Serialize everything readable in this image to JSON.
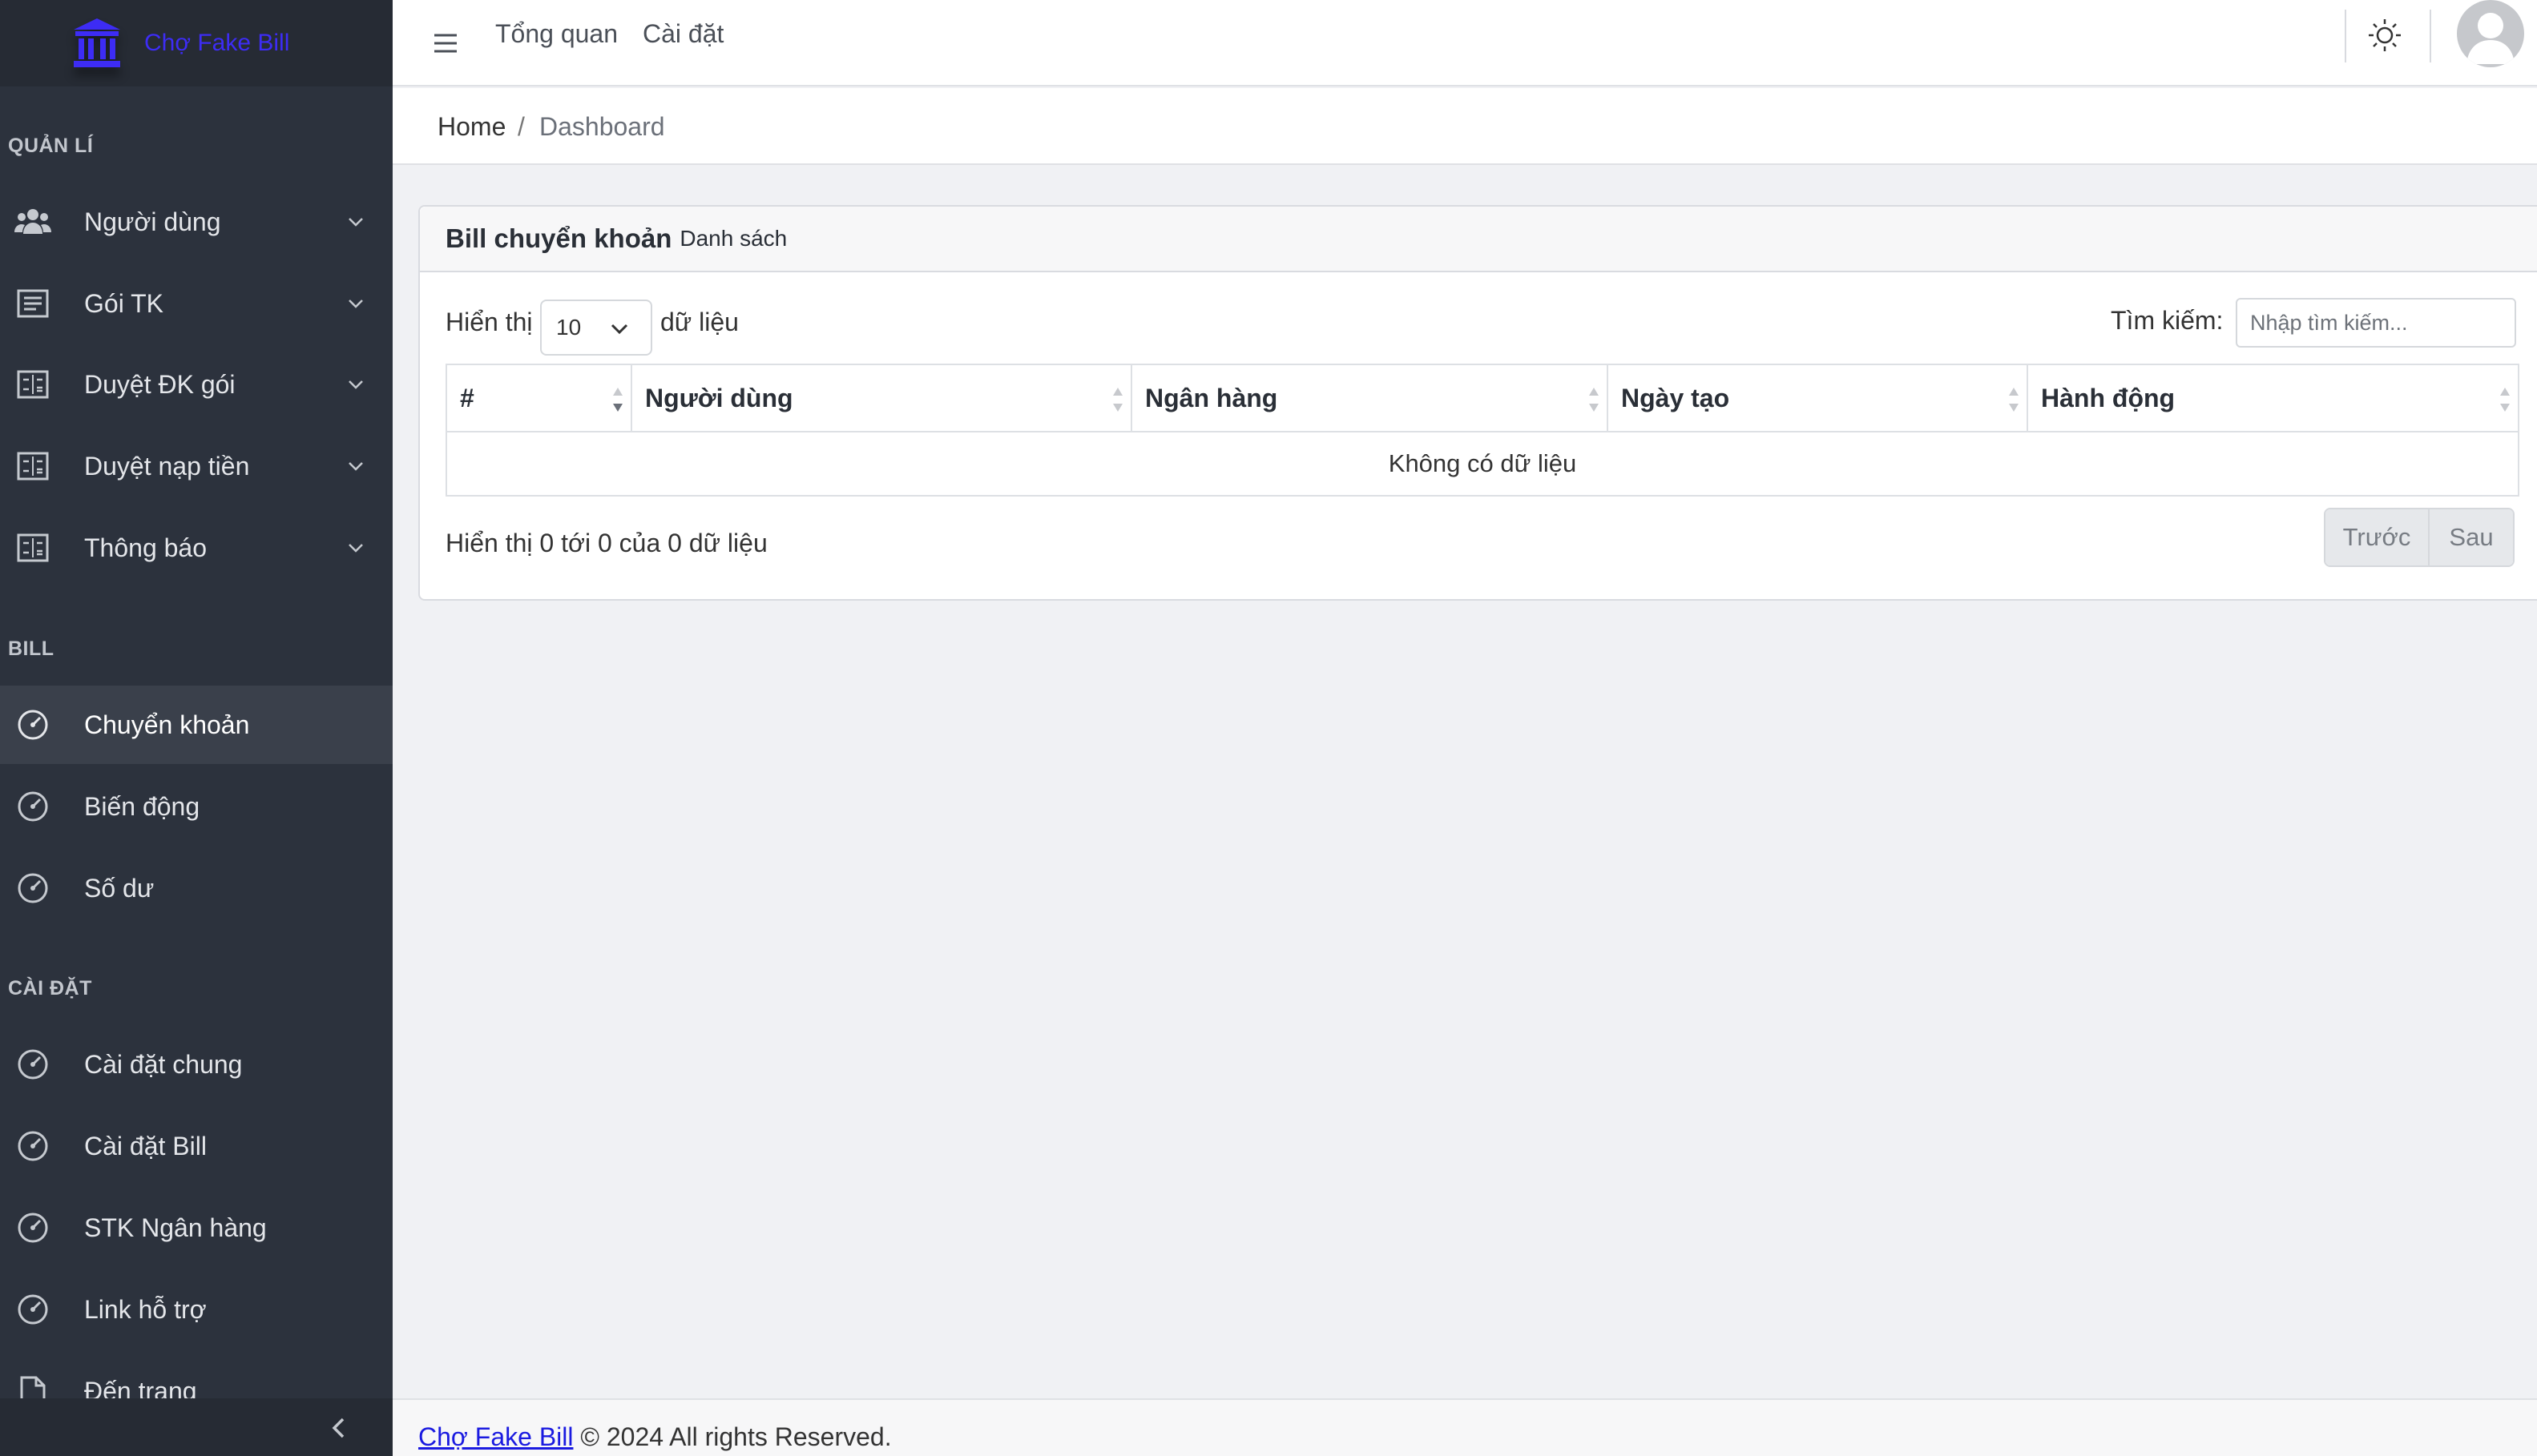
{
  "brand": {
    "name": "Chợ Fake Bill",
    "icon": "bank-icon",
    "color": "#3d2cf5"
  },
  "sidebar": {
    "sections": [
      {
        "title": "QUẢN LÍ"
      },
      {
        "title": "BILL"
      },
      {
        "title": "CÀI ĐẶT"
      }
    ],
    "items": [
      {
        "label": "Người dùng",
        "icon": "users-icon",
        "has_submenu": true
      },
      {
        "label": "Gói TK",
        "icon": "list-icon",
        "has_submenu": true
      },
      {
        "label": "Duyệt ĐK gói",
        "icon": "calculator-icon",
        "has_submenu": true
      },
      {
        "label": "Duyệt nạp tiền",
        "icon": "calculator-icon",
        "has_submenu": true
      },
      {
        "label": "Thông báo",
        "icon": "calculator-icon",
        "has_submenu": true
      },
      {
        "label": "Chuyển khoản",
        "icon": "speedometer-icon",
        "active": true
      },
      {
        "label": "Biến động",
        "icon": "speedometer-icon"
      },
      {
        "label": "Số dư",
        "icon": "speedometer-icon"
      },
      {
        "label": "Cài đặt chung",
        "icon": "speedometer-icon"
      },
      {
        "label": "Cài đặt Bill",
        "icon": "speedometer-icon"
      },
      {
        "label": "STK Ngân hàng",
        "icon": "speedometer-icon"
      },
      {
        "label": "Link hỗ trợ",
        "icon": "speedometer-icon"
      },
      {
        "label": "Đến trang",
        "icon": "file-icon"
      }
    ]
  },
  "header": {
    "nav": [
      "Tổng quan",
      "Cài đặt"
    ]
  },
  "breadcrumb": {
    "home": "Home",
    "separator": "/",
    "current": "Dashboard"
  },
  "card": {
    "title": "Bill chuyển khoản",
    "subtitle": "Danh sách",
    "length_prefix": "Hiển thị",
    "length_value": "10",
    "length_suffix": "dữ liệu",
    "search_label": "Tìm kiếm:",
    "search_placeholder": "Nhập tìm kiếm...",
    "columns": [
      "#",
      "Người dùng",
      "Ngân hàng",
      "Ngày tạo",
      "Hành động"
    ],
    "empty_text": "Không có dữ liệu",
    "info": "Hiển thị 0 tới 0 của 0 dữ liệu",
    "prev_label": "Trước",
    "next_label": "Sau"
  },
  "footer": {
    "link": "Chợ Fake Bill",
    "text": "© 2024 All rights Reserved."
  }
}
